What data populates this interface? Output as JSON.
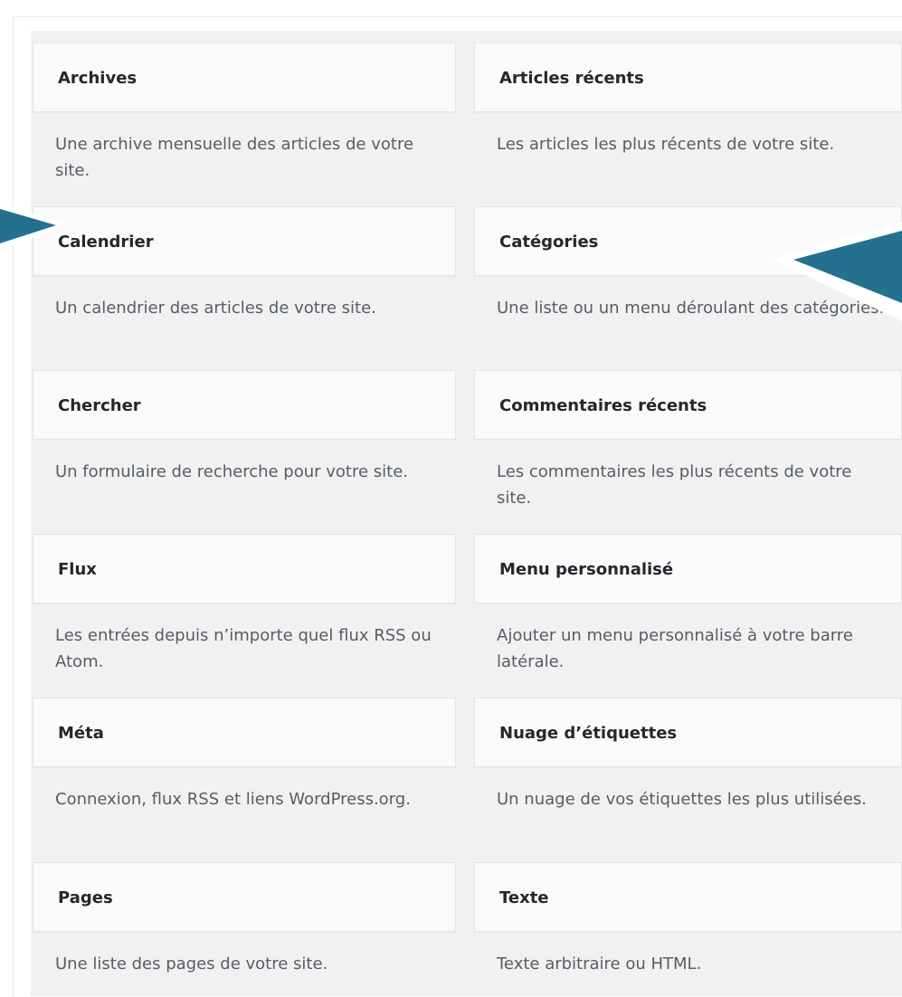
{
  "widgets": [
    {
      "title": "Archives",
      "description": "Une archive mensuelle des articles de votre site."
    },
    {
      "title": "Articles récents",
      "description": "Les articles les plus récents de votre site."
    },
    {
      "title": "Calendrier",
      "description": "Un calendrier des articles de votre site."
    },
    {
      "title": "Catégories",
      "description": "Une liste ou un menu déroulant des catégories."
    },
    {
      "title": "Chercher",
      "description": "Un formulaire de recherche pour votre site."
    },
    {
      "title": "Commentaires récents",
      "description": "Les commentaires les plus récents de votre site."
    },
    {
      "title": "Flux",
      "description": "Les entrées depuis n’importe quel flux RSS ou Atom."
    },
    {
      "title": "Menu personnalisé",
      "description": "Ajouter un menu personnalisé à votre barre latérale."
    },
    {
      "title": "Méta",
      "description": "Connexion, flux RSS et liens WordPress.org."
    },
    {
      "title": "Nuage d’étiquettes",
      "description": "Un nuage de vos étiquettes les plus utilisées."
    },
    {
      "title": "Pages",
      "description": "Une liste des pages de votre site."
    },
    {
      "title": "Texte",
      "description": "Texte arbitraire ou HTML."
    }
  ],
  "annotation_color": "#23708f"
}
